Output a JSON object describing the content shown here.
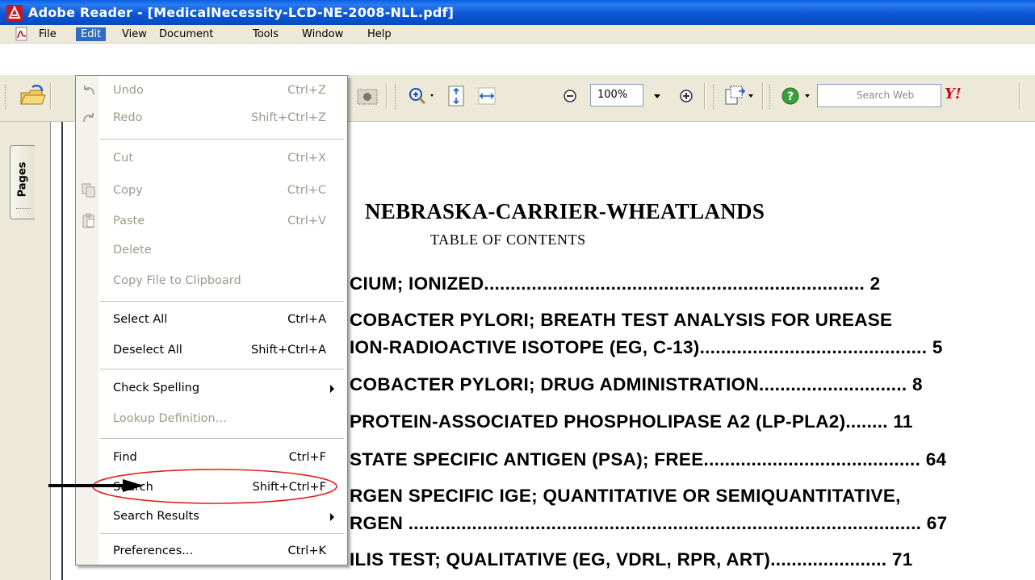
{
  "window": {
    "title": "Adobe Reader - [MedicalNecessity-LCD-NE-2008-NLL.pdf]"
  },
  "menubar": {
    "items": [
      "File",
      "Edit",
      "View",
      "Document",
      "Tools",
      "Window",
      "Help"
    ],
    "active": "Edit"
  },
  "toolbar": {
    "zoom_value": "100%",
    "search_placeholder": "Search Web",
    "yahoo_label": "Y!"
  },
  "left_panel": {
    "pages_tab": "Pages"
  },
  "edit_menu": {
    "items": [
      {
        "label": "Undo",
        "shortcut": "Ctrl+Z",
        "enabled": false,
        "icon": "undo-icon"
      },
      {
        "label": "Redo",
        "shortcut": "Shift+Ctrl+Z",
        "enabled": false,
        "icon": "redo-icon"
      },
      {
        "label": "Cut",
        "shortcut": "Ctrl+X",
        "enabled": false
      },
      {
        "label": "Copy",
        "shortcut": "Ctrl+C",
        "enabled": false,
        "icon": "copy-icon"
      },
      {
        "label": "Paste",
        "shortcut": "Ctrl+V",
        "enabled": false,
        "icon": "paste-icon"
      },
      {
        "label": "Delete",
        "shortcut": "",
        "enabled": false
      },
      {
        "label": "Copy File to Clipboard",
        "shortcut": "",
        "enabled": false
      },
      {
        "label": "Select All",
        "shortcut": "Ctrl+A",
        "enabled": true
      },
      {
        "label": "Deselect All",
        "shortcut": "Shift+Ctrl+A",
        "enabled": true
      },
      {
        "label": "Check Spelling",
        "shortcut": "",
        "enabled": true,
        "submenu": true
      },
      {
        "label": "Lookup Definition...",
        "shortcut": "",
        "enabled": false
      },
      {
        "label": "Find",
        "shortcut": "Ctrl+F",
        "enabled": true
      },
      {
        "label": "Search",
        "shortcut": "Shift+Ctrl+F",
        "enabled": true
      },
      {
        "label": "Search Results",
        "shortcut": "",
        "enabled": true,
        "submenu": true
      },
      {
        "label": "Preferences...",
        "shortcut": "Ctrl+K",
        "enabled": true
      }
    ]
  },
  "document": {
    "heading": "NEBRASKA-CARRIER-WHEATLANDS",
    "subheading": "TABLE OF CONTENTS",
    "toc_lines": [
      "CIUM; IONIZED........................................................................ 2",
      "COBACTER PYLORI; BREATH TEST ANALYSIS FOR UREASE",
      "ION-RADIOACTIVE ISOTOPE (EG, C-13)........................................... 5",
      "COBACTER PYLORI; DRUG ADMINISTRATION............................ 8",
      "PROTEIN-ASSOCIATED PHOSPHOLIPASE A2 (LP-PLA2)........ 11",
      "STATE SPECIFIC ANTIGEN (PSA); FREE......................................... 64",
      "RGEN SPECIFIC IGE; QUANTITATIVE OR SEMIQUANTITATIVE,",
      "RGEN ................................................................................................. 67",
      "ILIS TEST; QUALITATIVE (EG, VDRL, RPR, ART)...................... 71"
    ]
  },
  "colors": {
    "titlebar": "#0a5fe3",
    "menu_highlight": "#316ac5",
    "annotation_red": "#e0231f"
  }
}
